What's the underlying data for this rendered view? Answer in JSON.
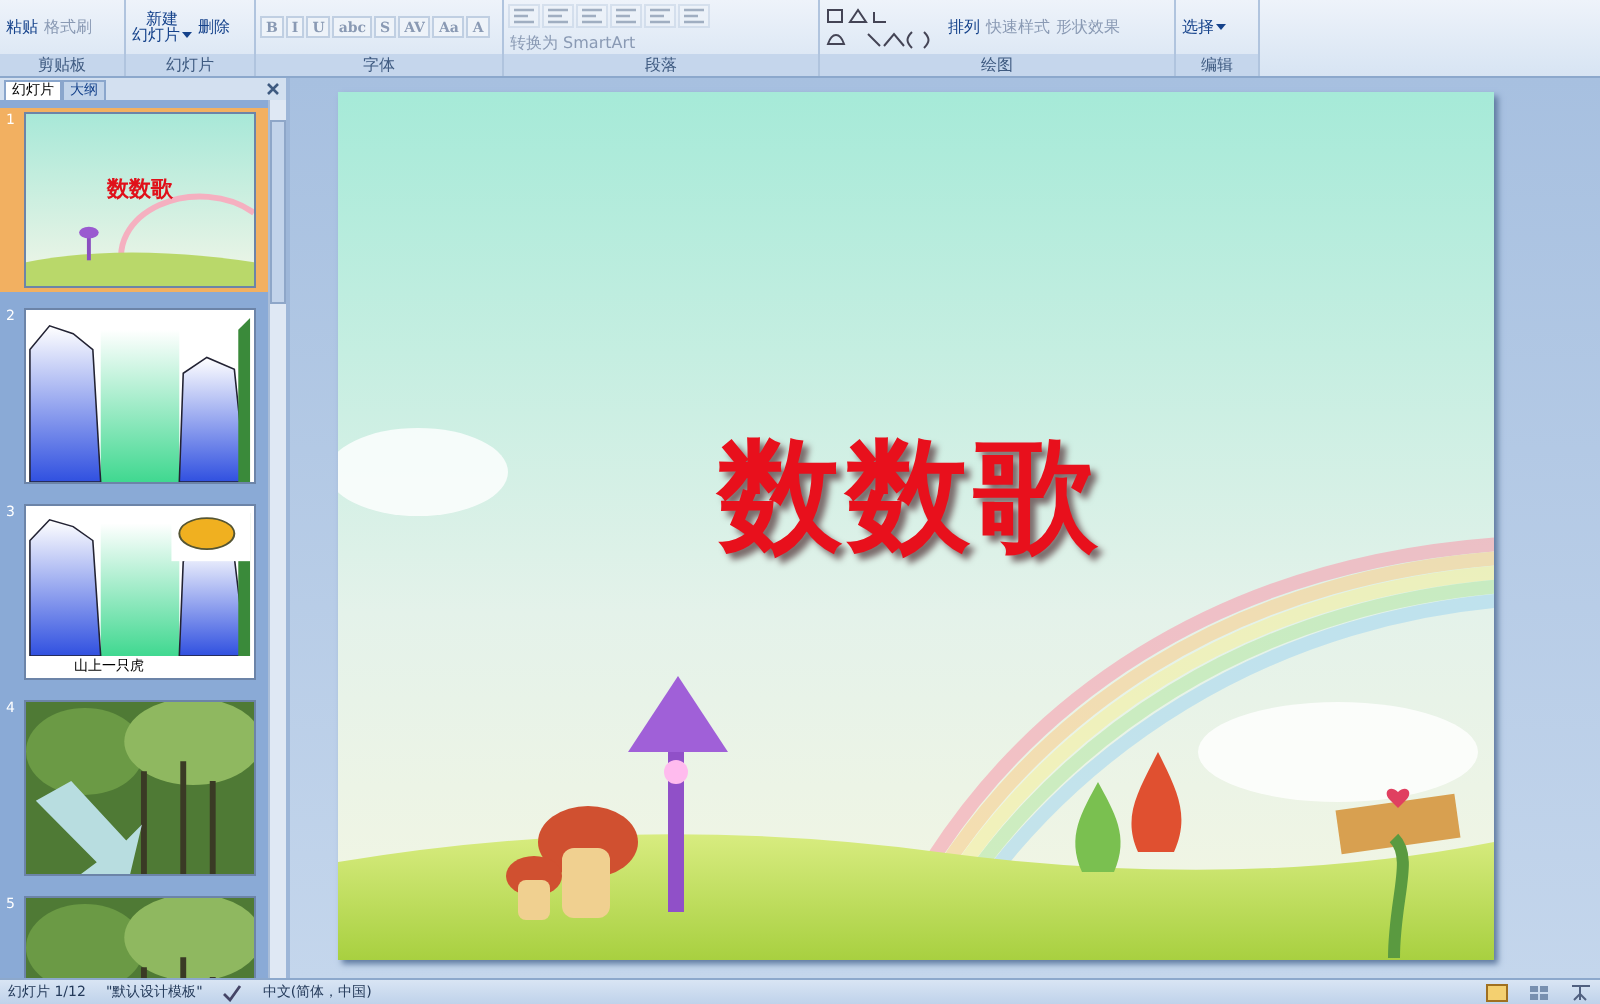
{
  "ribbon": {
    "groups": [
      {
        "label": "剪贴板",
        "buttons": [
          {
            "label": "粘贴",
            "kind": "large",
            "disabled": false
          },
          {
            "label": "格式刷",
            "kind": "small",
            "disabled": true
          }
        ]
      },
      {
        "label": "幻灯片",
        "buttons": [
          {
            "lines": [
              "新建",
              "幻灯片"
            ],
            "kind": "large",
            "caret": true,
            "disabled": false
          },
          {
            "label": "删除",
            "kind": "small",
            "disabled": false
          }
        ]
      },
      {
        "label": "字体",
        "buttons": [
          {
            "label": "B",
            "kind": "glyph",
            "disabled": true
          },
          {
            "label": "I",
            "kind": "glyph",
            "disabled": true
          },
          {
            "label": "U",
            "kind": "glyph",
            "disabled": true
          },
          {
            "label": "abc",
            "kind": "glyph",
            "disabled": true
          },
          {
            "label": "S",
            "kind": "glyph",
            "disabled": true
          },
          {
            "label": "AV",
            "kind": "glyph",
            "disabled": true
          },
          {
            "label": "Aa",
            "kind": "glyph",
            "disabled": true
          },
          {
            "label": "A",
            "kind": "glyph",
            "disabled": true
          }
        ]
      },
      {
        "label": "段落",
        "buttons": [
          {
            "kind": "align",
            "disabled": true
          },
          {
            "kind": "align",
            "disabled": true
          },
          {
            "kind": "align",
            "disabled": true
          },
          {
            "kind": "align",
            "disabled": true
          },
          {
            "kind": "align",
            "disabled": true
          },
          {
            "kind": "align",
            "disabled": true
          },
          {
            "label": "转换为 SmartArt",
            "kind": "small",
            "disabled": true
          }
        ]
      },
      {
        "label": "绘图",
        "buttons": [
          {
            "kind": "shapes",
            "disabled": false
          },
          {
            "label": "排列",
            "kind": "large",
            "disabled": false
          },
          {
            "label": "快速样式",
            "kind": "large",
            "disabled": true
          },
          {
            "label": "形状效果",
            "kind": "small",
            "disabled": true
          }
        ]
      },
      {
        "label": "编辑",
        "buttons": [
          {
            "label": "选择",
            "kind": "small",
            "caret": true,
            "disabled": false
          }
        ]
      }
    ]
  },
  "pane": {
    "tabs": [
      {
        "label": "幻灯片",
        "selected": true
      },
      {
        "label": "大纲",
        "selected": false
      }
    ],
    "slides": [
      {
        "number": "1",
        "kind": "title",
        "title": "数数歌",
        "selected": true
      },
      {
        "number": "2",
        "kind": "cliff",
        "selected": false
      },
      {
        "number": "3",
        "kind": "cliff_tiger",
        "caption": "山上一只虎",
        "selected": false
      },
      {
        "number": "4",
        "kind": "forest_arrow",
        "selected": false
      },
      {
        "number": "5",
        "kind": "forest",
        "selected": false
      }
    ]
  },
  "slide": {
    "title": "数数歌"
  },
  "status_bar": {
    "items": [
      "幻灯片 1/12",
      "\"默认设计模板\"",
      "中文(简体，中国)"
    ]
  }
}
